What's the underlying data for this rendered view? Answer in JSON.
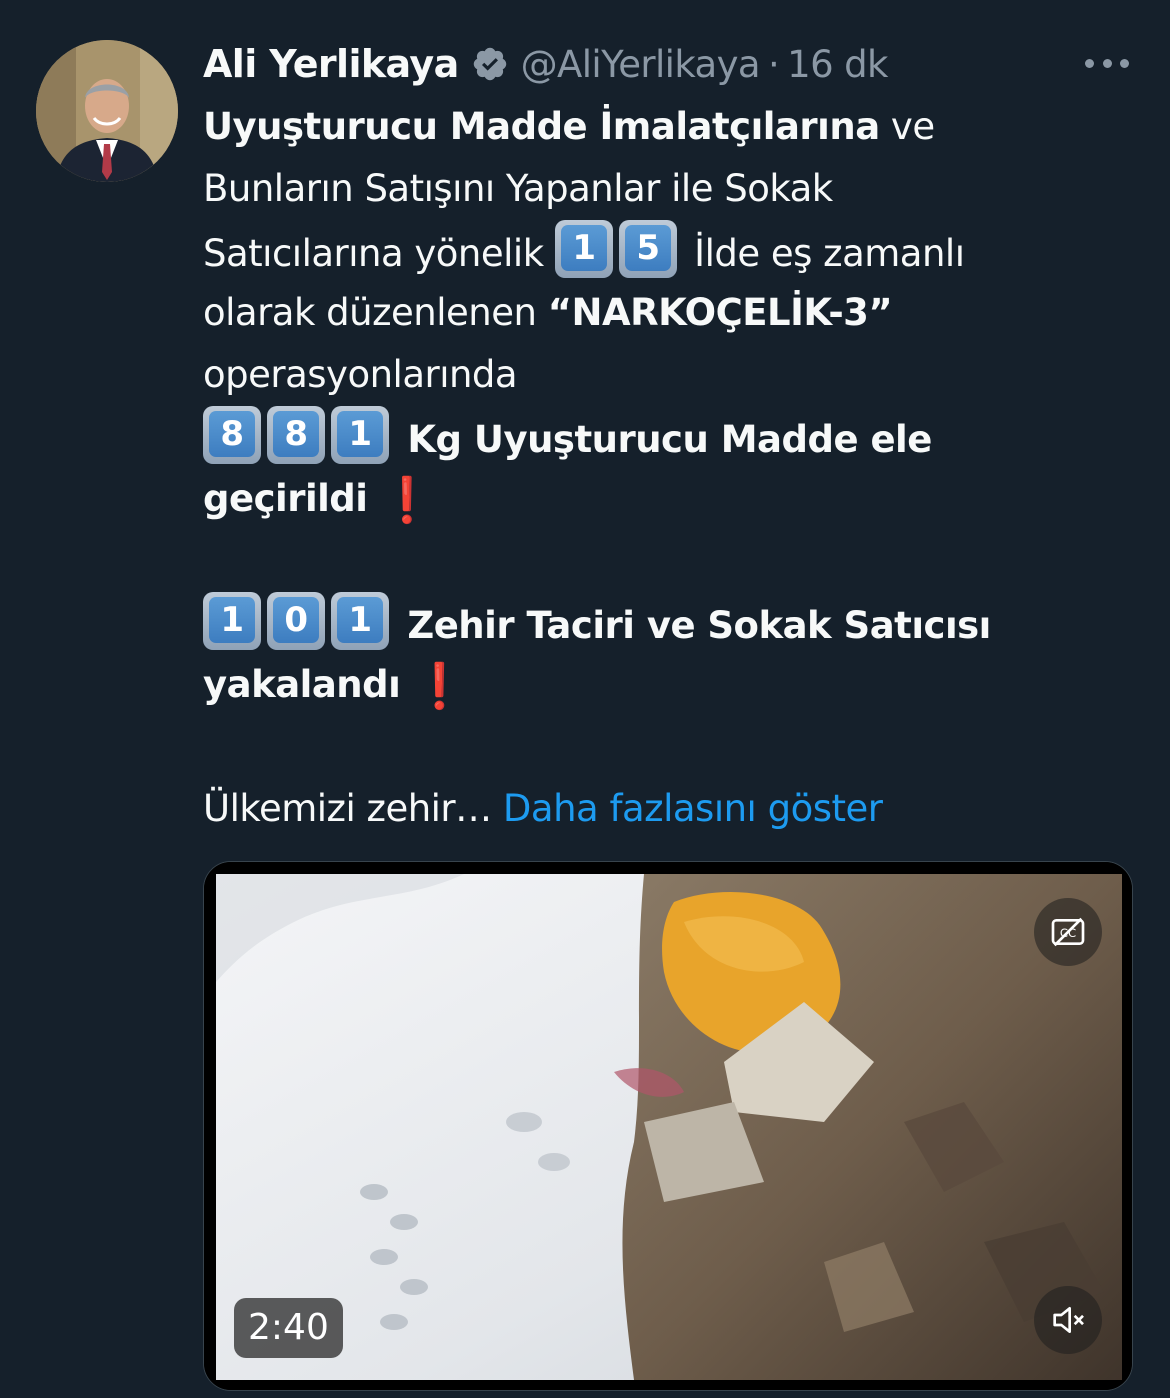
{
  "tweet": {
    "author": {
      "name": "Ali Yerlikaya",
      "handle": "@AliYerlikaya",
      "verified": true,
      "separator": "·",
      "time": "16 dk"
    },
    "body": {
      "line1_bold": "Uyuşturucu Madde İmalatçılarına",
      "line1_rest": " ve",
      "line2": "Bunların Satışını Yapanlar ile Sokak",
      "line3_pre": "Satıcılarına yönelik ",
      "provinces_digits": [
        "1",
        "5"
      ],
      "line3_post": " İlde eş zamanlı",
      "line4_pre": "olarak düzenlenen ",
      "line4_bold": "“NARKOÇELİK-3”",
      "line5": "operasyonlarında",
      "kg_digits": [
        "8",
        "8",
        "1"
      ],
      "line6_bold": " Kg Uyuşturucu Madde ele",
      "line7_bold": "geçirildi",
      "exclamation": "❗",
      "suspects_digits": [
        "1",
        "0",
        "1"
      ],
      "line8_bold": " Zehir Taciri ve Sokak Satıcısı",
      "line9_bold": "yakalandı",
      "line10": "Ülkemizi zehir…",
      "show_more": "Daha fazlasını göster"
    },
    "video": {
      "duration": "2:40",
      "captions_icon": "captions-off-icon",
      "mute_icon": "muted-speaker-icon"
    }
  },
  "colors": {
    "background": "#15202b",
    "text": "#f7f9f9",
    "secondary": "#8b98a5",
    "link": "#1d9bf0",
    "verified": "#8b98a5",
    "alert": "#e0202c"
  }
}
